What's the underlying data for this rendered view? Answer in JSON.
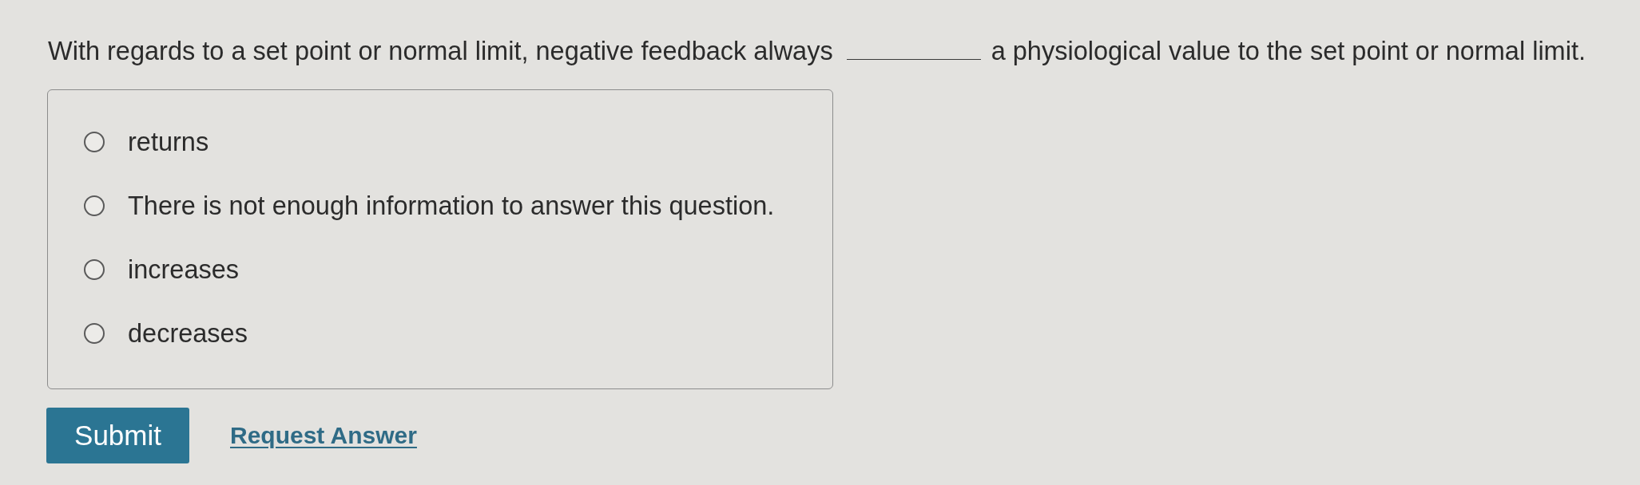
{
  "question": {
    "text_before": "With regards to a set point or normal limit, negative feedback always",
    "text_after": "a physiological value to the set point or normal limit."
  },
  "options": [
    {
      "label": "returns",
      "selected": false
    },
    {
      "label": "There is not enough information to answer this question.",
      "selected": false
    },
    {
      "label": "increases",
      "selected": false
    },
    {
      "label": "decreases",
      "selected": false
    }
  ],
  "actions": {
    "submit_button": "Submit",
    "request_answer_link": "Request Answer"
  }
}
